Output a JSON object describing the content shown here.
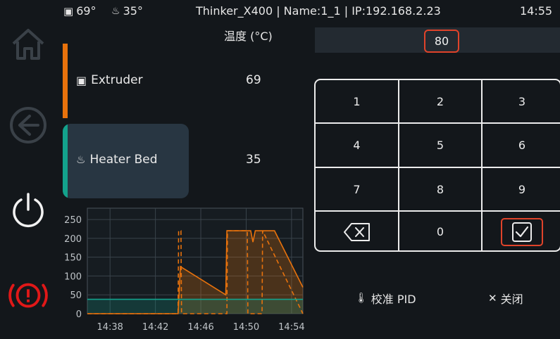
{
  "statusbar": {
    "extruder_temp": "69°",
    "bed_temp": "35°",
    "printer_info": "Thinker_X400 | Name:1_1 | IP:192.168.2.23",
    "clock": "14:55"
  },
  "header": {
    "temp_title": "温度 (°C)"
  },
  "heaters": [
    {
      "name": "Extruder",
      "temp": "69",
      "color": "#e8720c"
    },
    {
      "name": "Heater Bed",
      "temp": "35",
      "color": "#13a28c"
    }
  ],
  "input": {
    "value": "80"
  },
  "keypad": {
    "keys": [
      "1",
      "2",
      "3",
      "4",
      "5",
      "6",
      "7",
      "8",
      "9",
      "backspace",
      "0",
      "confirm"
    ],
    "calibrate_label": "校准 PID",
    "close_label": "关闭"
  },
  "chart_data": {
    "type": "line",
    "y_ticks": [
      "250",
      "200",
      "150",
      "100",
      "50",
      "0"
    ],
    "x_ticks": [
      "14:38",
      "14:42",
      "14:46",
      "14:50",
      "14:54"
    ],
    "ylim": [
      0,
      280
    ],
    "grid": true,
    "series": [
      {
        "color": "#e8720c",
        "style": "solid",
        "x": [
          "14:36",
          "14:44",
          "14:44.2",
          "14:48.2",
          "14:48.3",
          "14:50.4",
          "14:50.6",
          "14:50.8",
          "14:52.5",
          "14:55"
        ],
        "values": [
          0,
          0,
          125,
          50,
          220,
          220,
          190,
          220,
          220,
          70
        ]
      },
      {
        "color": "#e8720c",
        "style": "dashed",
        "x": [
          "14:36",
          "14:44",
          "14:44.05",
          "14:44.25",
          "14:44.3",
          "14:48.3",
          "14:48.35",
          "14:50.1",
          "14:50.15",
          "14:51.4",
          "14:51.45",
          "14:55"
        ],
        "values": [
          0,
          0,
          220,
          220,
          0,
          0,
          220,
          220,
          0,
          0,
          220,
          0
        ]
      },
      {
        "color": "#13a28c",
        "style": "solid",
        "x": [
          "14:36",
          "14:55"
        ],
        "values": [
          38,
          38
        ]
      }
    ]
  }
}
